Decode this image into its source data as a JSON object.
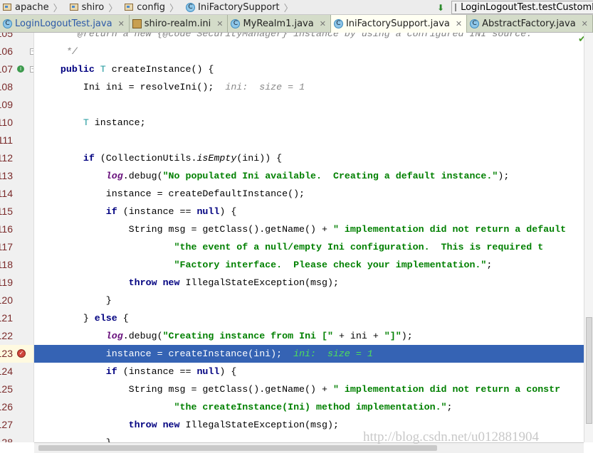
{
  "breadcrumb": [
    "apache",
    "shiro",
    "config",
    "IniFactorySupport"
  ],
  "run_config": "LoginLogoutTest.testCustomRealm",
  "tabs": [
    {
      "label": "LoginLogoutTest.java",
      "icon": "test-class-icon",
      "active": false
    },
    {
      "label": "shiro-realm.ini",
      "icon": "ini-file-icon",
      "active": false
    },
    {
      "label": "MyRealm1.java",
      "icon": "class-icon",
      "active": false
    },
    {
      "label": "IniFactorySupport.java",
      "icon": "abstract-class-icon",
      "active": true
    },
    {
      "label": "AbstractFactory.java",
      "icon": "abstract-class-icon",
      "active": false
    }
  ],
  "tabs_overflow": "▾≡5",
  "colors": {
    "highlight": "#3563b4",
    "keyword": "#000080",
    "string": "#008000"
  },
  "current_line": 123,
  "lines": [
    {
      "n": "105",
      "seg": [
        [
          "cm",
          "     * @return a new {@code SecurityManager} instance by using a configured INI source."
        ]
      ]
    },
    {
      "n": "106",
      "seg": [
        [
          "cm",
          "     */"
        ]
      ]
    },
    {
      "n": "107",
      "seg": [
        [
          "",
          "    "
        ],
        [
          "kw",
          "public"
        ],
        [
          "",
          " "
        ],
        [
          "ty",
          "T"
        ],
        [
          "",
          " createInstance() {"
        ]
      ]
    },
    {
      "n": "108",
      "seg": [
        [
          "",
          "        Ini ini = resolveIni();"
        ],
        [
          "inl",
          "  ini:  size = 1"
        ]
      ]
    },
    {
      "n": "109",
      "seg": []
    },
    {
      "n": "110",
      "seg": [
        [
          "",
          "        "
        ],
        [
          "ty",
          "T"
        ],
        [
          "",
          " instance;"
        ]
      ]
    },
    {
      "n": "111",
      "seg": []
    },
    {
      "n": "112",
      "seg": [
        [
          "",
          "        "
        ],
        [
          "kw",
          "if"
        ],
        [
          "",
          " (CollectionUtils."
        ],
        [
          "it",
          "isEmpty"
        ],
        [
          "",
          "(ini)) {"
        ]
      ]
    },
    {
      "n": "113",
      "seg": [
        [
          "",
          "            "
        ],
        [
          "fld",
          "log"
        ],
        [
          "",
          ".debug("
        ],
        [
          "str",
          "\"No populated Ini available.  Creating a default instance.\""
        ],
        [
          "",
          ");"
        ]
      ]
    },
    {
      "n": "114",
      "seg": [
        [
          "",
          "            instance = createDefaultInstance();"
        ]
      ]
    },
    {
      "n": "115",
      "seg": [
        [
          "",
          "            "
        ],
        [
          "kw",
          "if"
        ],
        [
          "",
          " (instance == "
        ],
        [
          "kw",
          "null"
        ],
        [
          "",
          ") {"
        ]
      ]
    },
    {
      "n": "116",
      "seg": [
        [
          "",
          "                String msg = getClass().getName() + "
        ],
        [
          "str",
          "\" implementation did not return a default"
        ]
      ]
    },
    {
      "n": "117",
      "seg": [
        [
          "",
          "                        "
        ],
        [
          "str",
          "\"the event of a null/empty Ini configuration.  This is required t"
        ]
      ]
    },
    {
      "n": "118",
      "seg": [
        [
          "",
          "                        "
        ],
        [
          "str",
          "\"Factory interface.  Please check your implementation.\""
        ],
        [
          "",
          ";"
        ]
      ]
    },
    {
      "n": "119",
      "seg": [
        [
          "",
          "                "
        ],
        [
          "kw",
          "throw"
        ],
        [
          "",
          " "
        ],
        [
          "kw",
          "new"
        ],
        [
          "",
          " IllegalStateException(msg);"
        ]
      ]
    },
    {
      "n": "120",
      "seg": [
        [
          "",
          "            }"
        ]
      ]
    },
    {
      "n": "121",
      "seg": [
        [
          "",
          "        } "
        ],
        [
          "kw",
          "else"
        ],
        [
          "",
          " {"
        ]
      ]
    },
    {
      "n": "122",
      "seg": [
        [
          "",
          "            "
        ],
        [
          "fld",
          "log"
        ],
        [
          "",
          ".debug("
        ],
        [
          "str",
          "\"Creating instance from Ini [\""
        ],
        [
          "",
          " + ini + "
        ],
        [
          "str",
          "\"]\""
        ],
        [
          "",
          ");"
        ]
      ]
    },
    {
      "n": "123",
      "seg": [
        [
          "",
          "            instance = createInstance(ini);"
        ],
        [
          "inl",
          "  ini:  size = 1"
        ]
      ]
    },
    {
      "n": "124",
      "seg": [
        [
          "",
          "            "
        ],
        [
          "kw",
          "if"
        ],
        [
          "",
          " (instance == "
        ],
        [
          "kw",
          "null"
        ],
        [
          "",
          ") {"
        ]
      ]
    },
    {
      "n": "125",
      "seg": [
        [
          "",
          "                String msg = getClass().getName() + "
        ],
        [
          "str",
          "\" implementation did not return a constr"
        ]
      ]
    },
    {
      "n": "126",
      "seg": [
        [
          "",
          "                        "
        ],
        [
          "str",
          "\"the createInstance(Ini) method implementation.\""
        ],
        [
          "",
          ";"
        ]
      ]
    },
    {
      "n": "127",
      "seg": [
        [
          "",
          "                "
        ],
        [
          "kw",
          "throw"
        ],
        [
          "",
          " "
        ],
        [
          "kw",
          "new"
        ],
        [
          "",
          " IllegalStateException(msg);"
        ]
      ]
    },
    {
      "n": "128",
      "seg": [
        [
          "",
          "            }"
        ]
      ]
    }
  ],
  "watermark": "http://blog.csdn.net/u012881904"
}
